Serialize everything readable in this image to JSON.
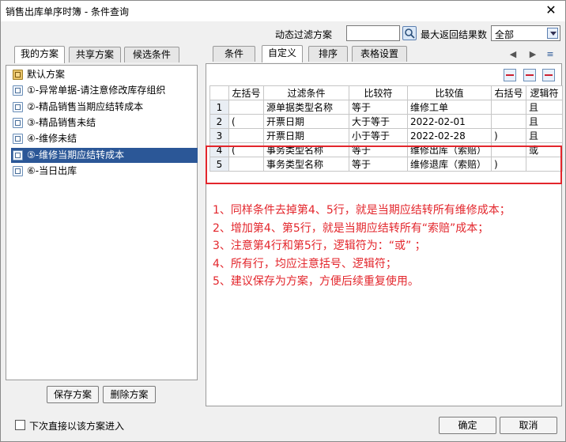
{
  "window": {
    "title": "销售出库单序时簿 - 条件查询",
    "close_glyph": "✕"
  },
  "filter_bar": {
    "dynamic_label": "动态过滤方案",
    "dynamic_value": "",
    "max_results_label": "最大返回结果数",
    "max_results_value": "全部"
  },
  "left_tabs": [
    "我的方案",
    "共享方案",
    "候选条件"
  ],
  "schemes": [
    "默认方案",
    "①-异常单据-请注意修改库存组织",
    "②-精品销售当期应结转成本",
    "③-精品销售未结",
    "④-维修未结",
    "⑤-维修当期应结转成本",
    "⑥-当日出库"
  ],
  "selected_scheme_index": 5,
  "left_buttons": {
    "save": "保存方案",
    "delete": "删除方案"
  },
  "right_tabs": [
    "条件",
    "自定义",
    "排序",
    "表格设置"
  ],
  "active_right_tab": 1,
  "grid": {
    "headers": [
      "",
      "左括号",
      "过滤条件",
      "比较符",
      "比较值",
      "右括号",
      "逻辑符"
    ],
    "rows": [
      {
        "num": "1",
        "lp": "",
        "field": "源单据类型名称",
        "op": "等于",
        "value": "维修工单",
        "rp": "",
        "logic": "且"
      },
      {
        "num": "2",
        "lp": "(",
        "field": "开票日期",
        "op": "大于等于",
        "value": "2022-02-01",
        "rp": "",
        "logic": "且"
      },
      {
        "num": "3",
        "lp": "",
        "field": "开票日期",
        "op": "小于等于",
        "value": "2022-02-28",
        "rp": ")",
        "logic": "且"
      },
      {
        "num": "4",
        "lp": "(",
        "field": "事务类型名称",
        "op": "等于",
        "value": "维修出库（索赔）",
        "rp": "",
        "logic": "或"
      },
      {
        "num": "5",
        "lp": "",
        "field": "事务类型名称",
        "op": "等于",
        "value": "维修退库（索赔）",
        "rp": ")",
        "logic": ""
      }
    ]
  },
  "notes": [
    "1、同样条件去掉第4、5行，就是当期应结转所有维修成本；",
    "2、增加第4、第5行，就是当期应结转所有“索赔”成本；",
    "3、注意第4行和第5行，逻辑符为：“或”  ；",
    "4、所有行，均应注意括号、逻辑符；",
    "5、建议保存为方案，方便后续重复使用。"
  ],
  "footer": {
    "checkbox_label": "下次直接以该方案进入",
    "ok": "确定",
    "cancel": "取消"
  },
  "colors": {
    "annotation_red": "#e3262c",
    "selection_blue": "#2b5797"
  }
}
